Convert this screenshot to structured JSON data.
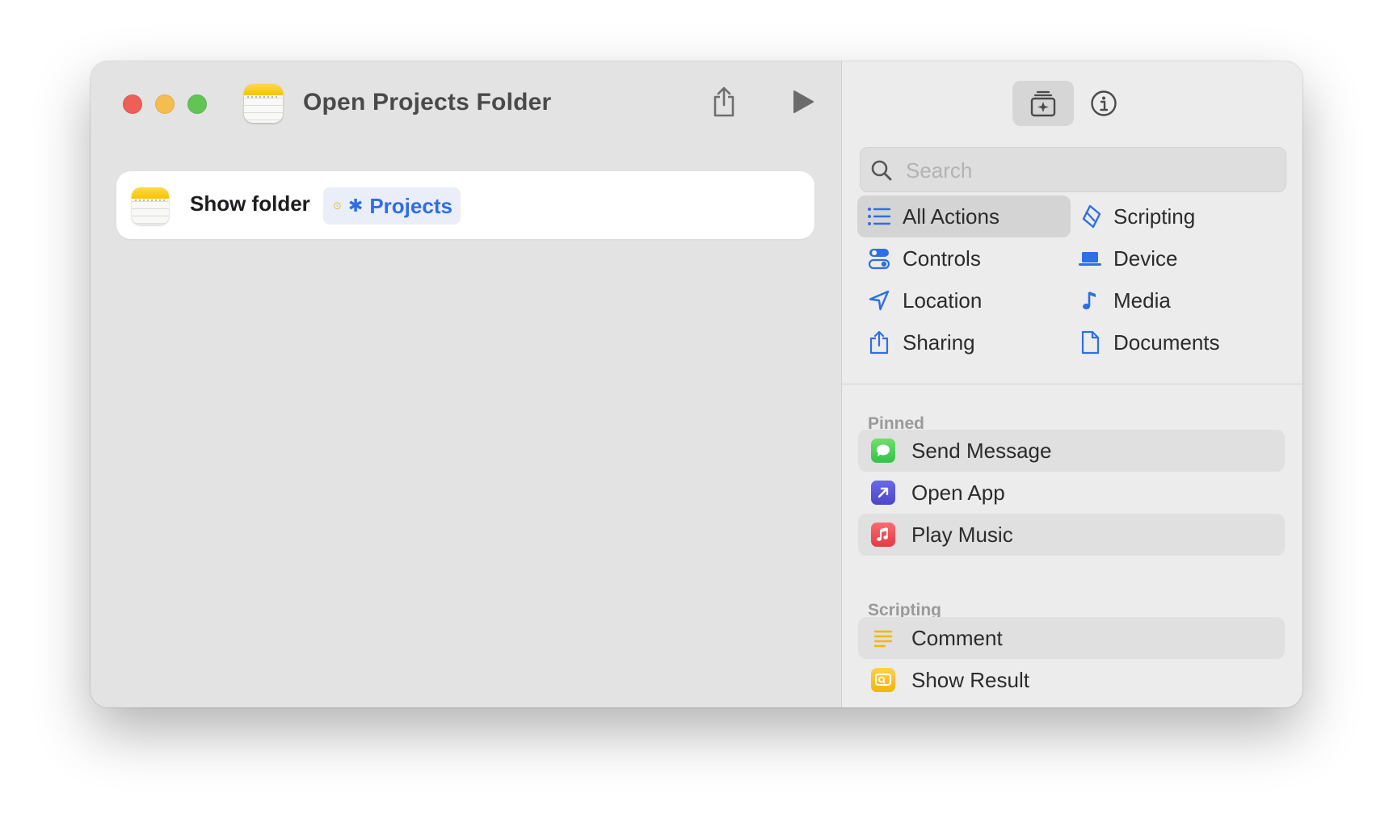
{
  "window": {
    "title": "Open Projects Folder"
  },
  "editor": {
    "action": {
      "label": "Show folder",
      "token": "Projects"
    }
  },
  "library": {
    "search": {
      "placeholder": "Search",
      "value": ""
    },
    "categories": [
      {
        "label": "All Actions",
        "icon": "list-icon",
        "selected": true
      },
      {
        "label": "Scripting",
        "icon": "scripting-icon",
        "selected": false
      },
      {
        "label": "Controls",
        "icon": "toggle-icon",
        "selected": false
      },
      {
        "label": "Device",
        "icon": "laptop-icon",
        "selected": false
      },
      {
        "label": "Location",
        "icon": "location-arrow-icon",
        "selected": false
      },
      {
        "label": "Media",
        "icon": "music-note-icon",
        "selected": false
      },
      {
        "label": "Sharing",
        "icon": "share-icon",
        "selected": false
      },
      {
        "label": "Documents",
        "icon": "document-icon",
        "selected": false
      }
    ],
    "sections": [
      {
        "title": "Pinned",
        "items": [
          {
            "label": "Send Message",
            "icon": "messages-icon"
          },
          {
            "label": "Open App",
            "icon": "open-app-icon"
          },
          {
            "label": "Play Music",
            "icon": "music-icon"
          }
        ]
      },
      {
        "title": "Scripting",
        "items": [
          {
            "label": "Comment",
            "icon": "comment-icon"
          },
          {
            "label": "Show Result",
            "icon": "show-result-icon"
          }
        ]
      }
    ]
  },
  "colors": {
    "accent": "#2f6ee5",
    "close": "#ee5f57",
    "minimize": "#f5bd4f",
    "zoom": "#61c454"
  }
}
